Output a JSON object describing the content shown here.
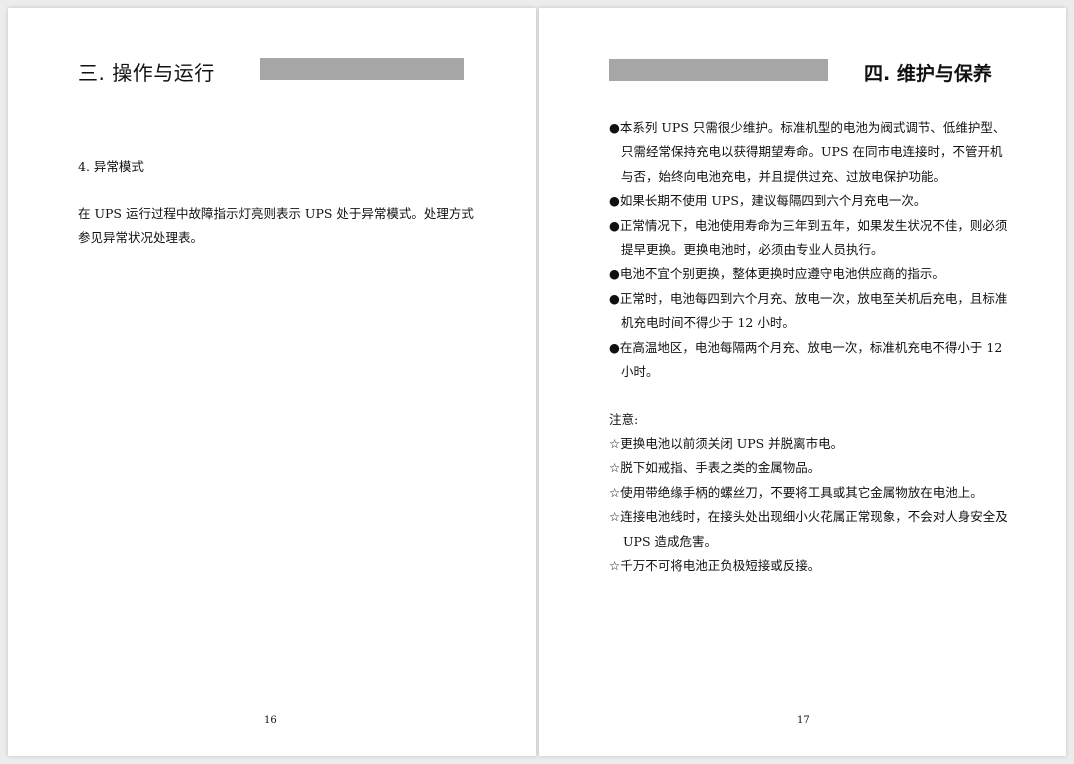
{
  "colors": {
    "background": "#ececec",
    "page": "#ffffff",
    "header_bar": "#a6a6a6"
  },
  "left_page": {
    "heading": "三. 操作与运行",
    "subheading": "4. 异常模式",
    "paragraph": "在 UPS 运行过程中故障指示灯亮则表示 UPS 处于异常模式。处理方式参见异常状况处理表。",
    "page_number": "16"
  },
  "right_page": {
    "heading": "四. 维护与保养",
    "bullet_mark": "●",
    "bullets": [
      "本系列 UPS 只需很少维护。标准机型的电池为阀式调节、低维护型、只需经常保持充电以获得期望寿命。UPS 在同市电连接时，不管开机与否，始终向电池充电，并且提供过充、过放电保护功能。",
      "如果长期不使用 UPS，建议每隔四到六个月充电一次。",
      "正常情况下，电池使用寿命为三年到五年，如果发生状况不佳，则必须提早更换。更换电池时，必须由专业人员执行。",
      "电池不宜个别更换，整体更换时应遵守电池供应商的指示。",
      "正常时，电池每四到六个月充、放电一次，放电至关机后充电，且标准机充电时间不得少于 12 小时。",
      "在高温地区，电池每隔两个月充、放电一次，标准机充电不得小于 12 小时。"
    ],
    "notes_title": "注意:",
    "note_mark": "☆",
    "notes": [
      "更换电池以前须关闭 UPS 并脱离市电。",
      "脱下如戒指、手表之类的金属物品。",
      "使用带绝缘手柄的螺丝刀，不要将工具或其它金属物放在电池上。",
      "连接电池线时，在接头处出现细小火花属正常现象，不会对人身安全及 UPS 造成危害。",
      "千万不可将电池正负极短接或反接。"
    ],
    "page_number": "17"
  }
}
